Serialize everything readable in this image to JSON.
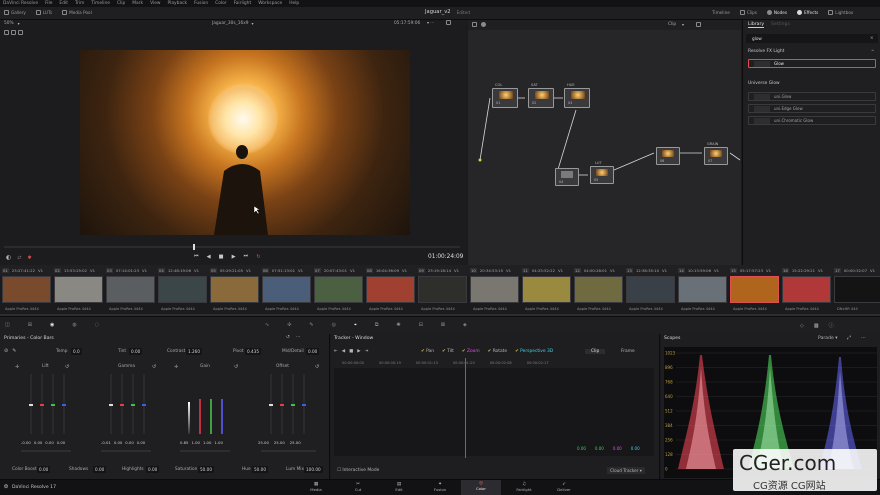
{
  "menubar": {
    "items": [
      "DaVinci Resolve",
      "File",
      "Edit",
      "Trim",
      "Timeline",
      "Clip",
      "Mark",
      "View",
      "Playback",
      "Fusion",
      "Color",
      "Fairlight",
      "Workspace",
      "Help"
    ],
    "project_title": "Jaguar_v2",
    "project_status": "Edited"
  },
  "toolbar": {
    "gallery": "Gallery",
    "luts": "LUTs",
    "media_pool": "Media Pool",
    "timeline": "Timeline",
    "clips": "Clips",
    "nodes": "Nodes",
    "effects": "Effects",
    "lightbox": "Lightbox"
  },
  "viewer": {
    "zoom": "50%",
    "timeline_name": "Jaguar_30s_16x9",
    "source_tc": "05:17:59:06",
    "timecode": "01:00:24:09",
    "clip_mode": "Clip"
  },
  "nodes": [
    {
      "label": "COL",
      "num": "01"
    },
    {
      "label": "SAT",
      "num": "02"
    },
    {
      "label": "HUE",
      "num": "03"
    },
    {
      "label": "LUT",
      "num": "05"
    },
    {
      "label": "",
      "num": "04"
    },
    {
      "label": "",
      "num": "06"
    },
    {
      "label": "GRAIN",
      "num": "07"
    }
  ],
  "library": {
    "tab_library": "Library",
    "tab_settings": "Settings",
    "search": "glow",
    "section1": "Resolve FX Light",
    "item_glow": "Glow",
    "section2": "Universe Glow",
    "items2": [
      "uni.Glow",
      "uni.Edge Glow",
      "uni.Chromatic Glow"
    ]
  },
  "timeline_clips": [
    {
      "num": "01",
      "tc": "23:27:41:22",
      "track": "V1"
    },
    {
      "num": "02",
      "tc": "13:53:25:02",
      "track": "V1"
    },
    {
      "num": "03",
      "tc": "07:14:01:23",
      "track": "V1"
    },
    {
      "num": "04",
      "tc": "12:48:19:06",
      "track": "V1"
    },
    {
      "num": "05",
      "tc": "05:29:21:05",
      "track": "V1"
    },
    {
      "num": "06",
      "tc": "07:51:13:01",
      "track": "V1"
    },
    {
      "num": "07",
      "tc": "20:07:43:01",
      "track": "V1"
    },
    {
      "num": "08",
      "tc": "16:04:36:09",
      "track": "V1"
    },
    {
      "num": "09",
      "tc": "23:19:18:14",
      "track": "V1"
    },
    {
      "num": "10",
      "tc": "20:34:53:15",
      "track": "V1"
    },
    {
      "num": "11",
      "tc": "04:25:52:22",
      "track": "V1"
    },
    {
      "num": "12",
      "tc": "04:00:28:01",
      "track": "V1"
    },
    {
      "num": "13",
      "tc": "12:38:35:10",
      "track": "V1"
    },
    {
      "num": "14",
      "tc": "10:13:59:06",
      "track": "V1"
    },
    {
      "num": "15",
      "tc": "05:17:57:23",
      "track": "V1"
    },
    {
      "num": "16",
      "tc": "15:22:29:21",
      "track": "V1"
    },
    {
      "num": "17",
      "tc": "00:00:32:07",
      "track": "V1"
    }
  ],
  "clip_codec": "Apple ProRes 4444",
  "clip_codec_last": "DNxHR 444",
  "primaries": {
    "title": "Primaries - Color Bars",
    "temp_label": "Temp",
    "temp": "0.0",
    "tint_label": "Tint",
    "tint": "0.00",
    "contrast_label": "Contrast",
    "contrast": "1.260",
    "pivot_label": "Pivot",
    "pivot": "0.435",
    "middetail_label": "Mid/Detail",
    "middetail": "0.00",
    "wheels": [
      {
        "name": "Lift",
        "values": [
          "-0.00",
          "0.00",
          "0.00",
          "0.00"
        ]
      },
      {
        "name": "Gamma",
        "values": [
          "-0.01",
          "0.00",
          "0.00",
          "0.00"
        ]
      },
      {
        "name": "Gain",
        "values": [
          "0.85",
          "1.00",
          "1.00",
          "1.00"
        ]
      },
      {
        "name": "Offset",
        "values": [
          "25.00",
          "25.00",
          "25.00"
        ]
      }
    ],
    "colorboost_label": "Color Boost",
    "colorboost": "0.00",
    "shadows_label": "Shadows",
    "shadows": "0.00",
    "highlights_label": "Highlights",
    "highlights": "0.00",
    "saturation_label": "Saturation",
    "saturation": "50.00",
    "hue_label": "Hue",
    "hue": "50.00",
    "lummix_label": "Lum Mix",
    "lummix": "100.00"
  },
  "tracker": {
    "title": "Tracker - Window",
    "options": [
      "Pan",
      "Tilt",
      "Zoom",
      "Rotate",
      "Perspective 3D"
    ],
    "mode_clip": "Clip",
    "mode_frame": "Frame",
    "ruler": [
      "00:00:00:00",
      "00:00:00:19",
      "00:00:01:13",
      "00:00:01:20",
      "00:00:02:08",
      "00:00:02:17"
    ],
    "values": [
      "0.00",
      "0.00",
      "0.00",
      "0.00"
    ],
    "interactive_label": "Interactive Mode",
    "cloud_tracker": "Cloud Tracker"
  },
  "scopes": {
    "title": "Scopes",
    "mode": "Parade",
    "ticks": [
      "1023",
      "896",
      "768",
      "640",
      "512",
      "384",
      "256",
      "128",
      "0"
    ],
    "colors": {
      "red": "#ff4a5a",
      "green": "#5cff6a",
      "blue": "#6a6aff"
    }
  },
  "bottom": {
    "app": "DaVinci Resolve 17",
    "pages": [
      "Media",
      "Cut",
      "Edit",
      "Fusion",
      "Color",
      "Fairlight",
      "Deliver"
    ],
    "active": "Color"
  },
  "watermark": {
    "main": "CGer.com",
    "sub": "CG资源 CG网站"
  }
}
